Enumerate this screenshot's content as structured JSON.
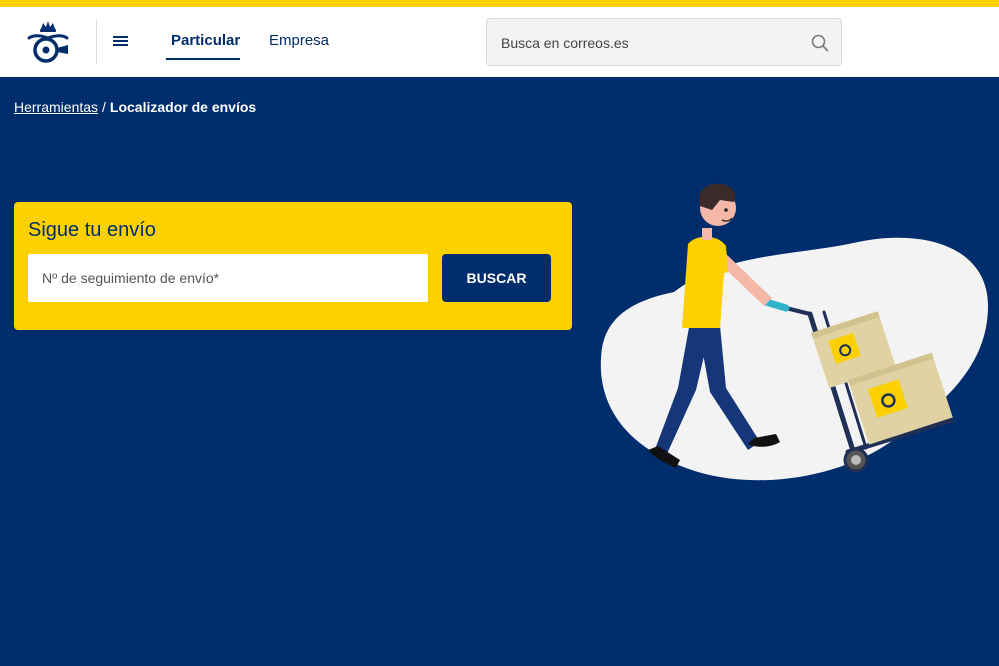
{
  "brand": {
    "name": "Correos",
    "accent": "#fdd100",
    "primary": "#002e6d"
  },
  "header": {
    "logo_icon": "correos-posthorn-crown-icon",
    "menu_icon": "hamburger-menu-icon",
    "tabs": [
      {
        "label": "Particular",
        "active": true
      },
      {
        "label": "Empresa",
        "active": false
      }
    ],
    "search": {
      "placeholder": "Busca en correos.es",
      "value": "",
      "icon": "search-icon"
    }
  },
  "breadcrumb": {
    "items": [
      {
        "label": "Herramientas"
      }
    ],
    "separator": "/",
    "current": "Localizador de envíos"
  },
  "tracking": {
    "title": "Sigue tu envío",
    "input_placeholder": "Nº de seguimiento de envío*",
    "input_value": "",
    "button_label": "BUSCAR"
  },
  "illustration": {
    "icon": "delivery-person-hand-truck-illustration"
  }
}
